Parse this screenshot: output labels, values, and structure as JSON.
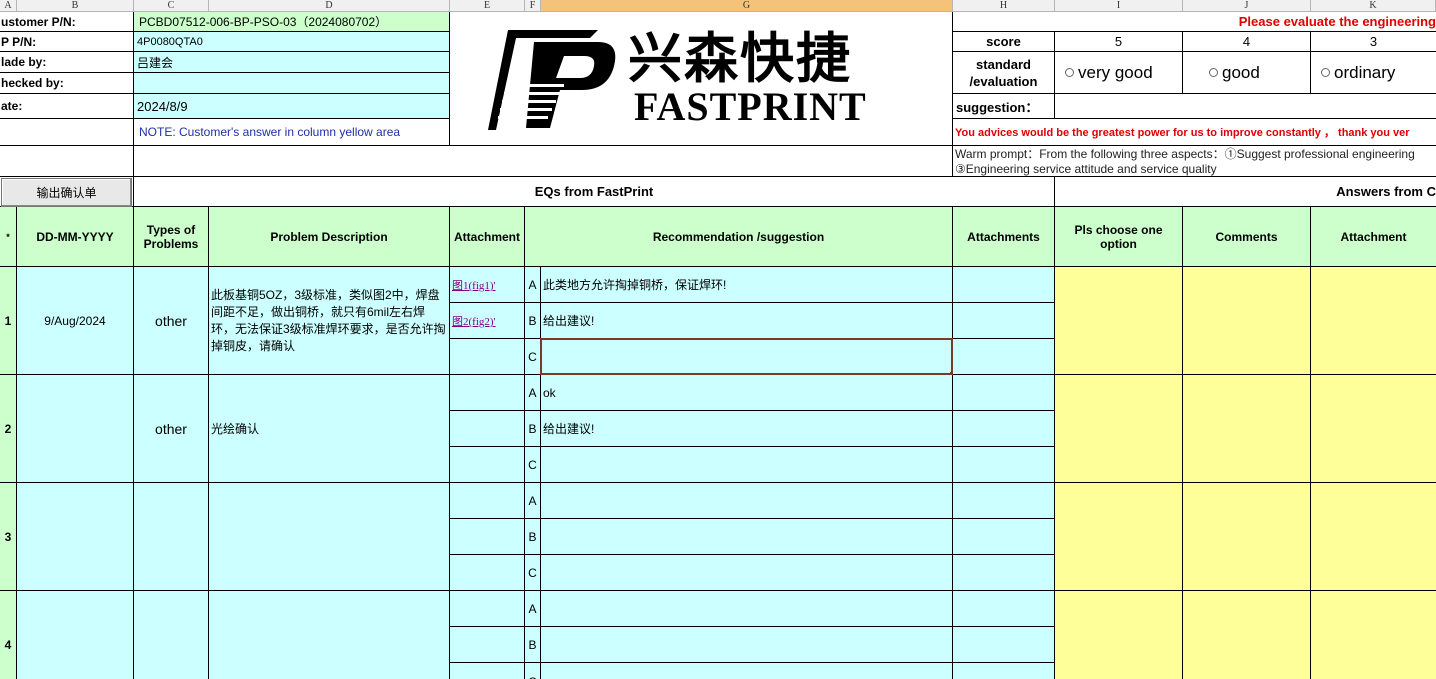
{
  "columns": [
    "A",
    "B",
    "C",
    "D",
    "E",
    "F",
    "G",
    "H",
    "I",
    "J",
    "K"
  ],
  "header": {
    "customer_pn_label": "ustomer P/N:",
    "customer_pn_value": "PCBD07512-006-BP-PSO-03（2024080702）",
    "fp_pn_label": "P P/N:",
    "fp_pn_value": "4P0080QTA0",
    "made_by_label": "lade by:",
    "made_by_value": "吕建会",
    "checked_by_label": "hecked by:",
    "checked_by_value": "",
    "date_label": "ate:",
    "date_value": "2024/8/9",
    "note": "NOTE: Customer's  answer in column yellow area"
  },
  "logo": {
    "cn": "兴森快捷",
    "en": "FASTPRINT"
  },
  "evaluation": {
    "title": "Please evaluate the engineering",
    "score_label": "score",
    "scores": [
      "5",
      "4",
      "3"
    ],
    "standard_label_1": "standard",
    "standard_label_2": "/evaluation",
    "options": [
      "very good",
      "good",
      "ordinary"
    ],
    "suggestion_label": "suggestion：",
    "advice": "You advices would be the greatest power for us to improve constantly ，  thank you ver",
    "warm_prompt_1": "Warm prompt：From the following three aspects：①Suggest professional engineering",
    "warm_prompt_2": "③Engineering service attitude and service quality"
  },
  "export_button": "输出确认单",
  "sections": {
    "eqs": "EQs from FastPrint",
    "answers": "Answers from C"
  },
  "table_headers": {
    "star": "*",
    "date": "DD-MM-YYYY",
    "types": "Types of Problems",
    "problem": "Problem Description",
    "attachment": "Attachment",
    "recommendation": "Recommendation /suggestion",
    "attachments": "Attachments",
    "choose": "Pls choose one option",
    "comments": "Comments",
    "attachment2": "Attachment"
  },
  "rows": [
    {
      "no": "1",
      "date": "9/Aug/2024",
      "type": "other",
      "problem": "此板基铜5OZ，3级标准，类似图2中，焊盘间距不足，做出铜桥，就只有6mil左右焊环，无法保证3级标准焊环要求，是否允许掏掉铜皮，请确认",
      "attachments": [
        "图1(fig1)'",
        "图2(fig2)'",
        ""
      ],
      "options": [
        {
          "letter": "A",
          "text": "此类地方允许掏掉铜桥，保证焊环!"
        },
        {
          "letter": "B",
          "text": "给出建议!"
        },
        {
          "letter": "C",
          "text": ""
        }
      ]
    },
    {
      "no": "2",
      "date": "",
      "type": "other",
      "problem": "光绘确认",
      "attachments": [
        "",
        "",
        ""
      ],
      "options": [
        {
          "letter": "A",
          "text": "ok"
        },
        {
          "letter": "B",
          "text": "给出建议!"
        },
        {
          "letter": "C",
          "text": ""
        }
      ]
    },
    {
      "no": "3",
      "date": "",
      "type": "",
      "problem": "",
      "attachments": [
        "",
        "",
        ""
      ],
      "options": [
        {
          "letter": "A",
          "text": ""
        },
        {
          "letter": "B",
          "text": ""
        },
        {
          "letter": "C",
          "text": ""
        }
      ]
    },
    {
      "no": "4",
      "date": "",
      "type": "",
      "problem": "",
      "attachments": [
        "",
        "",
        ""
      ],
      "options": [
        {
          "letter": "A",
          "text": ""
        },
        {
          "letter": "B",
          "text": ""
        },
        {
          "letter": "C",
          "text": ""
        }
      ]
    }
  ]
}
